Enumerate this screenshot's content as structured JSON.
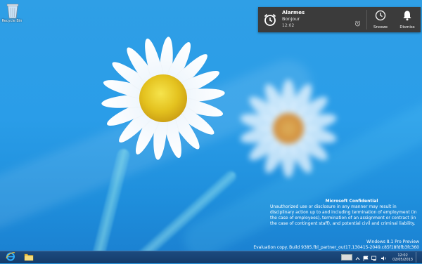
{
  "desktop": {
    "recycle_bin_label": "Recycle Bin"
  },
  "toast": {
    "app": "Alarmes",
    "message": "Bonjour",
    "time": "12:02",
    "snooze_label": "Snooze",
    "dismiss_label": "Dismiss",
    "icons": [
      "alarm-clock-icon",
      "small-alarm-icon",
      "snooze-icon",
      "bell-icon"
    ]
  },
  "watermark": {
    "heading": "Microsoft Confidential",
    "body": "Unauthorized use or disclosure in any manner may result in disciplinary action up to and including termination of employment (in the case of employees), termination of an assignment or contract (in the case of contingent staff), and potential civil and criminal liability.",
    "edition": "Windows 8.1 Pro Preview",
    "build": "Evaluation copy. Build 9385.fbl_partner_out17.130415-2049.c85f18fdfb3fc360"
  },
  "taskbar": {
    "apps": [
      "internet-explorer-icon",
      "file-explorer-icon"
    ],
    "tray_icons": [
      "keyboard-icon",
      "chevron-up-icon",
      "flag-icon",
      "network-icon",
      "volume-icon"
    ],
    "clock_time": "12:02",
    "clock_date": "02/05/2013"
  },
  "colors": {
    "wallpaper": "#2a9de8",
    "toast_bg": "#3b3b3b",
    "taskbar": "#1c4678"
  }
}
